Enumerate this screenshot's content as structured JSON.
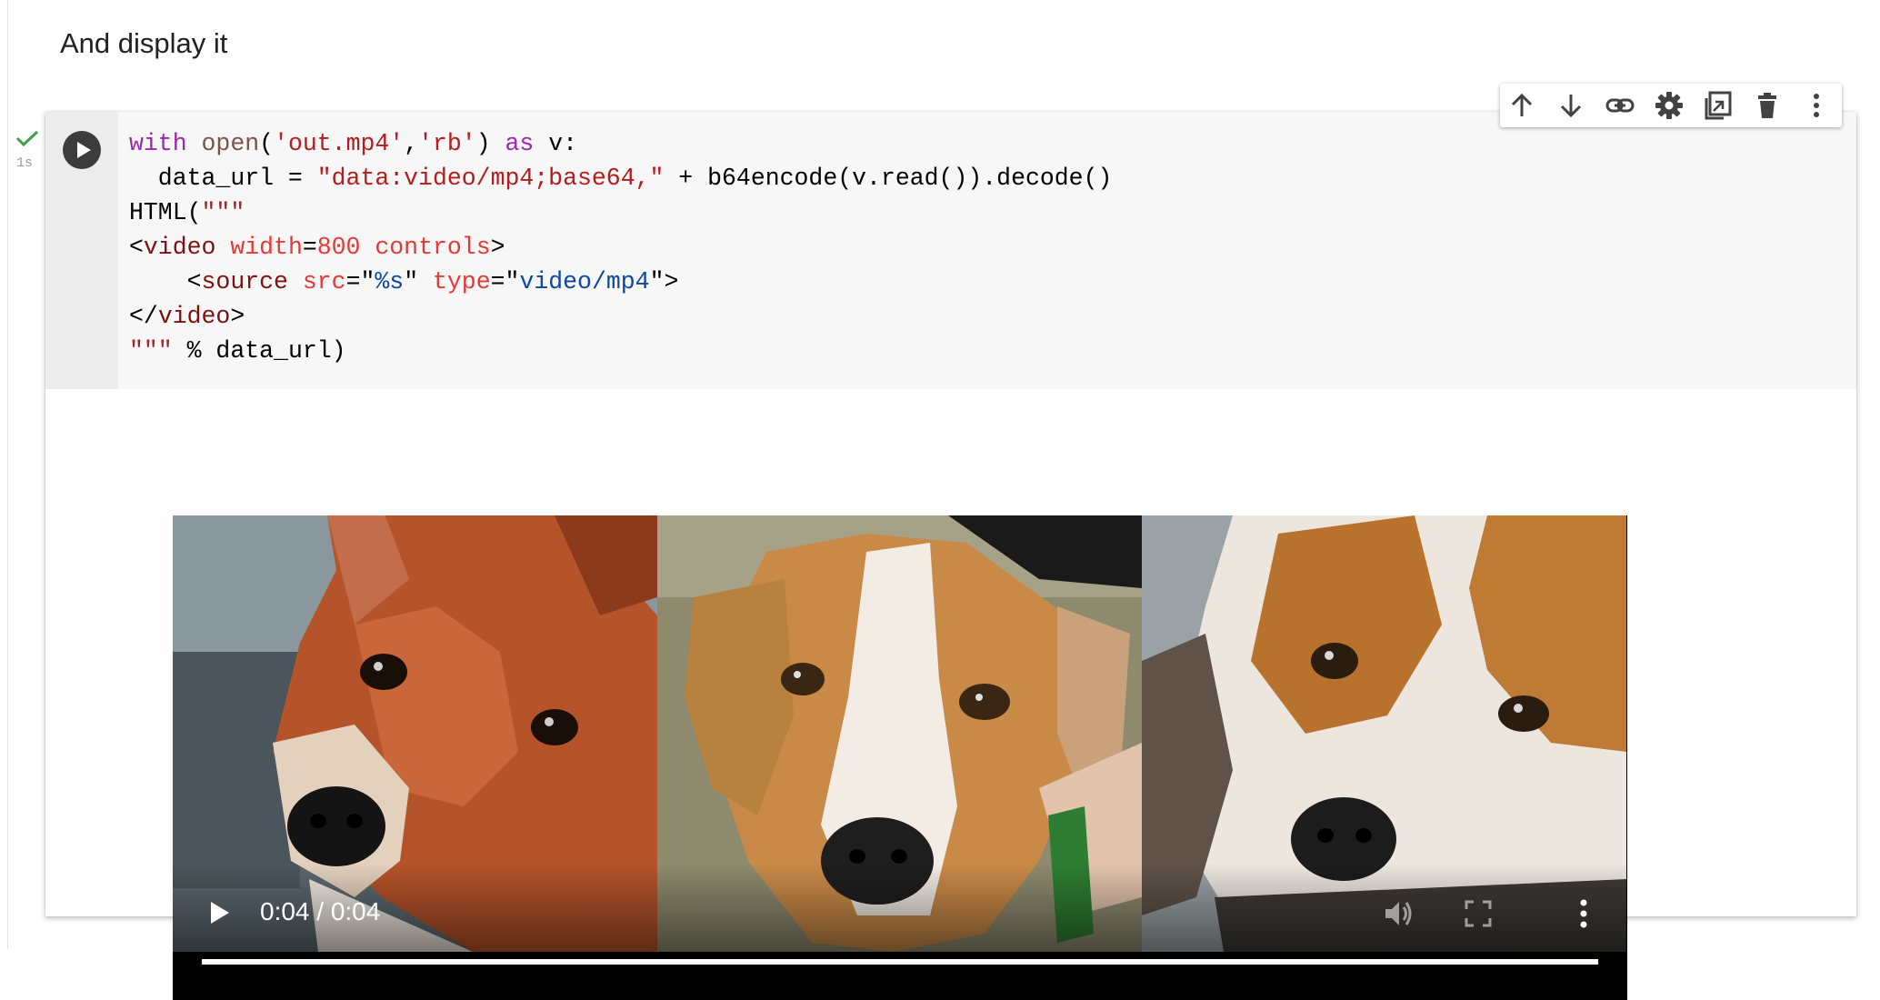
{
  "markdown": {
    "text": "And display it"
  },
  "cell": {
    "exec_time": "1s",
    "code_lines": [
      [
        [
          "kw",
          "with"
        ],
        [
          "",
          " "
        ],
        [
          "fn",
          "open"
        ],
        [
          "",
          "("
        ],
        [
          "str",
          "'out.mp4'"
        ],
        [
          "",
          ","
        ],
        [
          "str",
          "'rb'"
        ],
        [
          "",
          ") "
        ],
        [
          "kw",
          "as"
        ],
        [
          "",
          " v:"
        ]
      ],
      [
        [
          "",
          "  data_url = "
        ],
        [
          "str",
          "\"data:video/mp4;base64,\""
        ],
        [
          "",
          " + b64encode(v.read()).decode()"
        ]
      ],
      [
        [
          "",
          "HTML("
        ],
        [
          "str",
          "\"\"\""
        ]
      ],
      [
        [
          "",
          "<"
        ],
        [
          "tag",
          "video"
        ],
        [
          "",
          " "
        ],
        [
          "attr",
          "width"
        ],
        [
          "",
          "="
        ],
        [
          "num",
          "800"
        ],
        [
          "",
          " "
        ],
        [
          "attr",
          "controls"
        ],
        [
          "",
          ">"
        ]
      ],
      [
        [
          "",
          "    <"
        ],
        [
          "tag",
          "source"
        ],
        [
          "",
          " "
        ],
        [
          "attr",
          "src"
        ],
        [
          "",
          "=\""
        ],
        [
          "sv",
          "%s"
        ],
        [
          "",
          "\" "
        ],
        [
          "attr",
          "type"
        ],
        [
          "",
          "=\""
        ],
        [
          "sv",
          "video/mp4"
        ],
        [
          "",
          "\">"
        ]
      ],
      [
        [
          "",
          "</"
        ],
        [
          "tag",
          "video"
        ],
        [
          "",
          ">"
        ]
      ],
      [
        [
          "str",
          "\"\"\""
        ],
        [
          "",
          " % data_url)"
        ]
      ]
    ]
  },
  "toolbar": {
    "items": [
      "arrow-up-icon",
      "arrow-down-icon",
      "link-icon",
      "gear-icon",
      "mirror-cell-icon",
      "delete-icon",
      "more-vert-icon"
    ]
  },
  "video": {
    "time": "0:04 / 0:04",
    "progress": 1.0
  },
  "colors": {
    "keyword": "#9c27b0",
    "string": "#b71c1c",
    "tag": "#801010",
    "attribute": "#e53935",
    "string_value": "#0d47a1",
    "check": "#43a047"
  }
}
